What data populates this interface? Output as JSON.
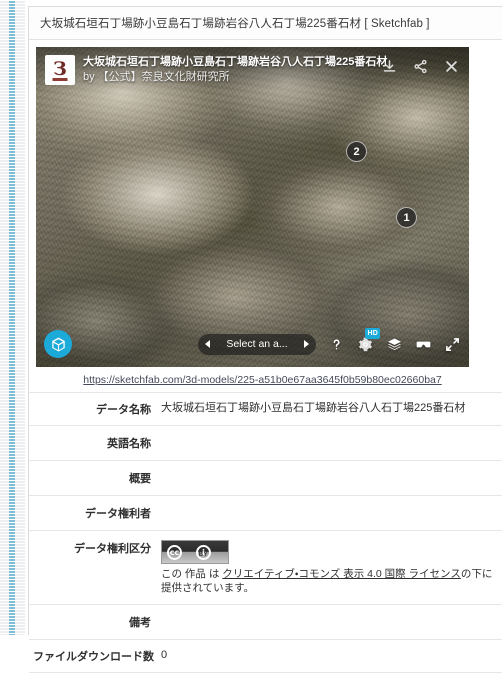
{
  "page": {
    "title": "大坂城石垣石丁場跡小豆島石丁場跡岩谷八人石丁場225番石材 [ Sketchfab ]"
  },
  "viewer": {
    "model_title": "大坂城石垣石丁場跡小豆島石丁場跡岩谷八人石丁場225番石材",
    "author_line": "by 【公式】奈良文化財研究所",
    "avatar_glyph": "З",
    "header_actions": [
      {
        "name": "download-icon",
        "label": "Download"
      },
      {
        "name": "share-icon",
        "label": "Share"
      },
      {
        "name": "close-icon",
        "label": "Close"
      }
    ],
    "annotations": [
      {
        "id": "2",
        "label": "2"
      },
      {
        "id": "1",
        "label": "1"
      }
    ],
    "annotation_selector": {
      "label": "Select an a...",
      "prev": "◀",
      "next": "▶"
    },
    "toolbar": [
      {
        "name": "help-icon",
        "label": "?"
      },
      {
        "name": "settings-gear-icon",
        "label": "Settings",
        "badge": "HD"
      },
      {
        "name": "layers-icon",
        "label": "Quality"
      },
      {
        "name": "vr-goggles-icon",
        "label": "View in VR"
      },
      {
        "name": "fullscreen-icon",
        "label": "Fullscreen"
      }
    ],
    "logo_label": "Sketchfab"
  },
  "model_link": {
    "text": "https://sketchfab.com/3d-models/225-a51b0e67aa3645f0b59b80ec02660ba7"
  },
  "metadata": {
    "rows": [
      {
        "label": "データ名称",
        "value": "大坂城石垣石丁場跡小豆島石丁場跡岩谷八人石丁場225番石材"
      },
      {
        "label": "英語名称",
        "value": ""
      },
      {
        "label": "概要",
        "value": ""
      },
      {
        "label": "データ権利者",
        "value": ""
      },
      {
        "label": "データ権利区分",
        "value": ""
      },
      {
        "label": "備考",
        "value": ""
      },
      {
        "label": "ファイルダウンロード数",
        "value": "0"
      }
    ]
  },
  "license": {
    "badge_cc": "cc",
    "badge_by_glyph": "i",
    "badge_by_text": "BY",
    "prefix": "この 作品 は ",
    "link_text": "クリエイティブ・コモンズ 表示 4.0 国際 ライセンス",
    "suffix": "の下に提供されています。"
  },
  "colors": {
    "accent": "#1caad9",
    "link": "#444a5a",
    "border": "#e6e6e6",
    "gutter_blue": "#8cc4dc"
  }
}
